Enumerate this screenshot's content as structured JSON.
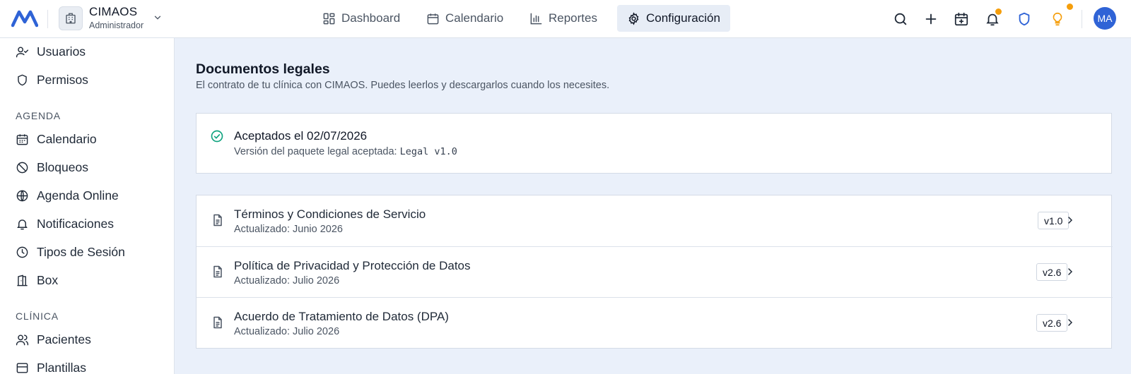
{
  "org": {
    "name": "CIMAOS",
    "role": "Administrador"
  },
  "nav": [
    {
      "label": "Dashboard",
      "icon": "dashboard-icon"
    },
    {
      "label": "Calendario",
      "icon": "calendar-icon"
    },
    {
      "label": "Reportes",
      "icon": "bar-chart-icon"
    },
    {
      "label": "Configuración",
      "icon": "gear-icon",
      "active": true
    }
  ],
  "user": {
    "initials": "MA"
  },
  "sidebar": {
    "top_items": [
      {
        "label": "Usuarios",
        "icon": "user-check-icon"
      },
      {
        "label": "Permisos",
        "icon": "shield-icon"
      }
    ],
    "section_agenda": "AGENDA",
    "agenda_items": [
      {
        "label": "Calendario",
        "icon": "calendar-icon"
      },
      {
        "label": "Bloqueos",
        "icon": "ban-icon"
      },
      {
        "label": "Agenda Online",
        "icon": "globe-icon"
      },
      {
        "label": "Notificaciones",
        "icon": "bell-icon"
      },
      {
        "label": "Tipos de Sesión",
        "icon": "clock-icon"
      },
      {
        "label": "Box",
        "icon": "door-icon"
      }
    ],
    "section_clinica": "CLÍNICA",
    "clinica_items": [
      {
        "label": "Pacientes",
        "icon": "users-icon"
      },
      {
        "label": "Plantillas",
        "icon": "template-icon"
      }
    ]
  },
  "page": {
    "title": "Documentos legales",
    "subtitle": "El contrato de tu clínica con CIMAOS. Puedes leerlos y descargarlos cuando los necesites."
  },
  "acceptance": {
    "prefix": "Aceptados el",
    "date": "02/07/2026",
    "version_label": "Versión del paquete legal aceptada:",
    "version_value": "Legal v1.0"
  },
  "documents": [
    {
      "title": "Términos y Condiciones de Servicio",
      "updated": "Actualizado: Junio 2026",
      "version": "v1.0"
    },
    {
      "title": "Política de Privacidad y Protección de Datos",
      "updated": "Actualizado: Julio 2026",
      "version": "v2.6"
    },
    {
      "title": "Acuerdo de Tratamiento de Datos (DPA)",
      "updated": "Actualizado: Julio 2026",
      "version": "v2.6"
    }
  ],
  "colors": {
    "brand": "#2f63d6",
    "success": "#10a37f",
    "notification_dot": "#f59e0b",
    "active_nav_bg": "#e7edf6"
  }
}
